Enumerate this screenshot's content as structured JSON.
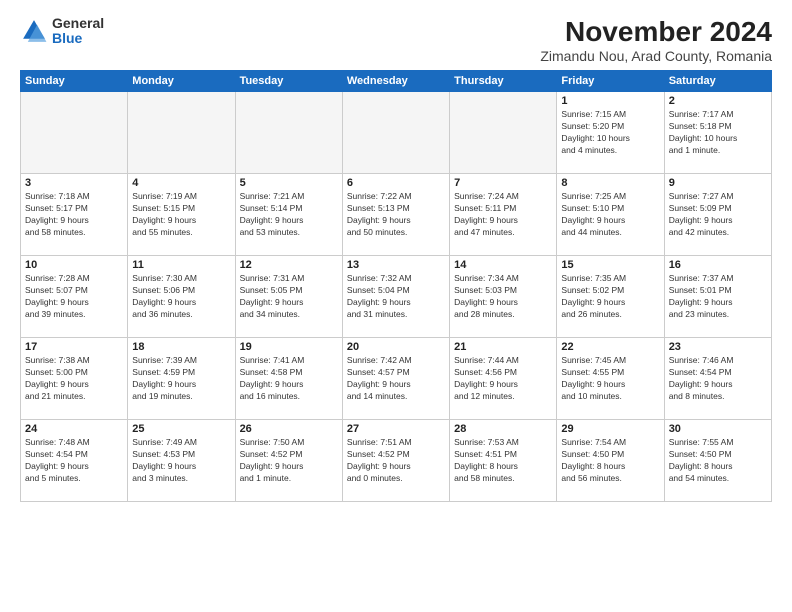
{
  "logo": {
    "general": "General",
    "blue": "Blue"
  },
  "title": "November 2024",
  "subtitle": "Zimandu Nou, Arad County, Romania",
  "weekdays": [
    "Sunday",
    "Monday",
    "Tuesday",
    "Wednesday",
    "Thursday",
    "Friday",
    "Saturday"
  ],
  "weeks": [
    [
      {
        "day": "",
        "info": ""
      },
      {
        "day": "",
        "info": ""
      },
      {
        "day": "",
        "info": ""
      },
      {
        "day": "",
        "info": ""
      },
      {
        "day": "",
        "info": ""
      },
      {
        "day": "1",
        "info": "Sunrise: 7:15 AM\nSunset: 5:20 PM\nDaylight: 10 hours\nand 4 minutes."
      },
      {
        "day": "2",
        "info": "Sunrise: 7:17 AM\nSunset: 5:18 PM\nDaylight: 10 hours\nand 1 minute."
      }
    ],
    [
      {
        "day": "3",
        "info": "Sunrise: 7:18 AM\nSunset: 5:17 PM\nDaylight: 9 hours\nand 58 minutes."
      },
      {
        "day": "4",
        "info": "Sunrise: 7:19 AM\nSunset: 5:15 PM\nDaylight: 9 hours\nand 55 minutes."
      },
      {
        "day": "5",
        "info": "Sunrise: 7:21 AM\nSunset: 5:14 PM\nDaylight: 9 hours\nand 53 minutes."
      },
      {
        "day": "6",
        "info": "Sunrise: 7:22 AM\nSunset: 5:13 PM\nDaylight: 9 hours\nand 50 minutes."
      },
      {
        "day": "7",
        "info": "Sunrise: 7:24 AM\nSunset: 5:11 PM\nDaylight: 9 hours\nand 47 minutes."
      },
      {
        "day": "8",
        "info": "Sunrise: 7:25 AM\nSunset: 5:10 PM\nDaylight: 9 hours\nand 44 minutes."
      },
      {
        "day": "9",
        "info": "Sunrise: 7:27 AM\nSunset: 5:09 PM\nDaylight: 9 hours\nand 42 minutes."
      }
    ],
    [
      {
        "day": "10",
        "info": "Sunrise: 7:28 AM\nSunset: 5:07 PM\nDaylight: 9 hours\nand 39 minutes."
      },
      {
        "day": "11",
        "info": "Sunrise: 7:30 AM\nSunset: 5:06 PM\nDaylight: 9 hours\nand 36 minutes."
      },
      {
        "day": "12",
        "info": "Sunrise: 7:31 AM\nSunset: 5:05 PM\nDaylight: 9 hours\nand 34 minutes."
      },
      {
        "day": "13",
        "info": "Sunrise: 7:32 AM\nSunset: 5:04 PM\nDaylight: 9 hours\nand 31 minutes."
      },
      {
        "day": "14",
        "info": "Sunrise: 7:34 AM\nSunset: 5:03 PM\nDaylight: 9 hours\nand 28 minutes."
      },
      {
        "day": "15",
        "info": "Sunrise: 7:35 AM\nSunset: 5:02 PM\nDaylight: 9 hours\nand 26 minutes."
      },
      {
        "day": "16",
        "info": "Sunrise: 7:37 AM\nSunset: 5:01 PM\nDaylight: 9 hours\nand 23 minutes."
      }
    ],
    [
      {
        "day": "17",
        "info": "Sunrise: 7:38 AM\nSunset: 5:00 PM\nDaylight: 9 hours\nand 21 minutes."
      },
      {
        "day": "18",
        "info": "Sunrise: 7:39 AM\nSunset: 4:59 PM\nDaylight: 9 hours\nand 19 minutes."
      },
      {
        "day": "19",
        "info": "Sunrise: 7:41 AM\nSunset: 4:58 PM\nDaylight: 9 hours\nand 16 minutes."
      },
      {
        "day": "20",
        "info": "Sunrise: 7:42 AM\nSunset: 4:57 PM\nDaylight: 9 hours\nand 14 minutes."
      },
      {
        "day": "21",
        "info": "Sunrise: 7:44 AM\nSunset: 4:56 PM\nDaylight: 9 hours\nand 12 minutes."
      },
      {
        "day": "22",
        "info": "Sunrise: 7:45 AM\nSunset: 4:55 PM\nDaylight: 9 hours\nand 10 minutes."
      },
      {
        "day": "23",
        "info": "Sunrise: 7:46 AM\nSunset: 4:54 PM\nDaylight: 9 hours\nand 8 minutes."
      }
    ],
    [
      {
        "day": "24",
        "info": "Sunrise: 7:48 AM\nSunset: 4:54 PM\nDaylight: 9 hours\nand 5 minutes."
      },
      {
        "day": "25",
        "info": "Sunrise: 7:49 AM\nSunset: 4:53 PM\nDaylight: 9 hours\nand 3 minutes."
      },
      {
        "day": "26",
        "info": "Sunrise: 7:50 AM\nSunset: 4:52 PM\nDaylight: 9 hours\nand 1 minute."
      },
      {
        "day": "27",
        "info": "Sunrise: 7:51 AM\nSunset: 4:52 PM\nDaylight: 9 hours\nand 0 minutes."
      },
      {
        "day": "28",
        "info": "Sunrise: 7:53 AM\nSunset: 4:51 PM\nDaylight: 8 hours\nand 58 minutes."
      },
      {
        "day": "29",
        "info": "Sunrise: 7:54 AM\nSunset: 4:50 PM\nDaylight: 8 hours\nand 56 minutes."
      },
      {
        "day": "30",
        "info": "Sunrise: 7:55 AM\nSunset: 4:50 PM\nDaylight: 8 hours\nand 54 minutes."
      }
    ]
  ]
}
